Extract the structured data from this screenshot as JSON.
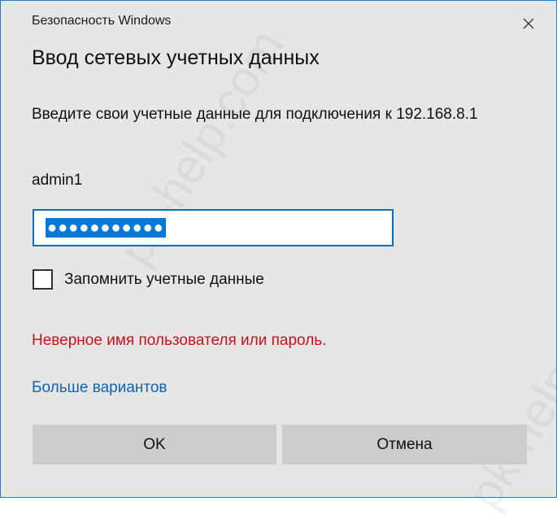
{
  "window": {
    "title": "Безопасность Windows",
    "close_icon": "close-icon"
  },
  "dialog": {
    "heading": "Ввод сетевых учетных данных",
    "prompt": "Введите свои учетные данные для подключения к 192.168.8.1",
    "username": "admin1",
    "password_masked": "●●●●●●●●●●●",
    "remember_checked": false,
    "remember_label": "Запомнить учетные данные",
    "error_message": "Неверное имя пользователя или пароль.",
    "more_options_link": "Больше вариантов"
  },
  "buttons": {
    "ok_label": "OK",
    "cancel_label": "Отмена"
  },
  "watermark": {
    "text": "pk-help.com"
  },
  "colors": {
    "accent": "#0078d7",
    "error": "#c5121b",
    "link": "#0a64b4",
    "dialog_bg": "#e6e6e6"
  }
}
